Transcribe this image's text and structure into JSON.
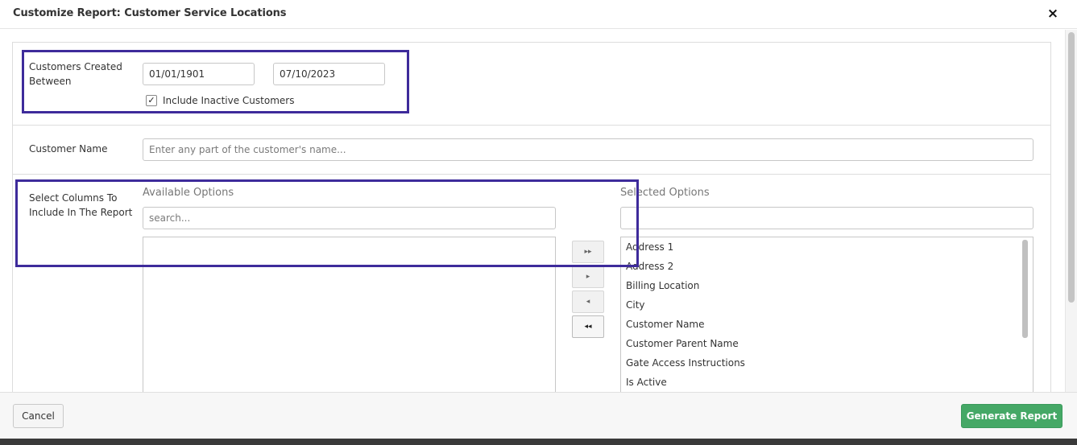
{
  "dialog": {
    "title": "Customize Report: Customer Service Locations",
    "close_glyph": "×"
  },
  "filters": {
    "created_between": {
      "label_line1": "Customers Created",
      "label_line2": "Between",
      "start_date": "01/01/1901",
      "end_date": "07/10/2023",
      "include_inactive_label": "Include Inactive Customers",
      "include_inactive_checked": true
    },
    "customer_name": {
      "label": "Customer Name",
      "placeholder": "Enter any part of the customer's name..."
    }
  },
  "columns": {
    "label_line1": "Select Columns To",
    "label_line2": "Include In The Report",
    "available_heading": "Available Options",
    "available_search_placeholder": "search...",
    "available_items": [],
    "selected_heading": "Selected Options",
    "selected_search_value": "",
    "selected_items": [
      "Address 1",
      "Address 2",
      "Billing Location",
      "City",
      "Customer Name",
      "Customer Parent Name",
      "Gate Access Instructions",
      "Is Active"
    ],
    "move_buttons": {
      "add_all": "▸▸",
      "add_one": "▸",
      "remove_one": "◂",
      "remove_all": "◂◂"
    }
  },
  "footer": {
    "cancel_label": "Cancel",
    "generate_label": "Generate Report"
  },
  "colors": {
    "highlight": "#3e2b9b",
    "primary_button": "#45a866"
  }
}
